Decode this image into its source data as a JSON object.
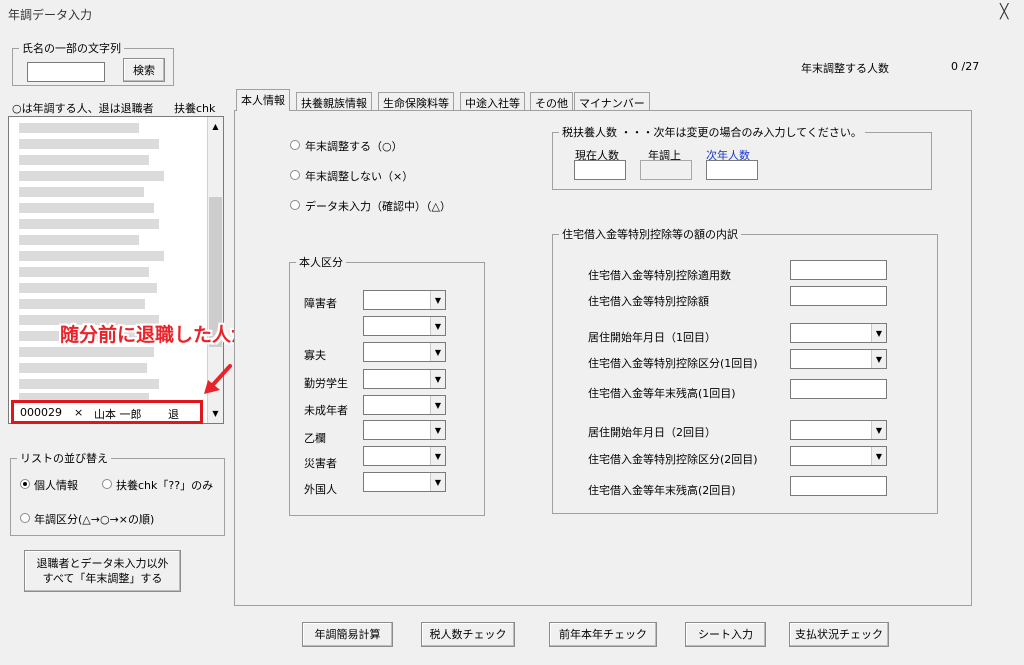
{
  "window": {
    "title": "年調データ入力",
    "close_glyph": "╳"
  },
  "search": {
    "group_label": "氏名の一部の文字列",
    "input_value": "",
    "button": "検索"
  },
  "summary": {
    "label": "年末調整する人数",
    "value": "0 /27"
  },
  "list": {
    "header_left": "○は年調する人、退は退職者",
    "header_right": "扶養chk",
    "highlight_row": {
      "code": "000029",
      "mark": "×",
      "name": "山本 一郎",
      "status": "退"
    },
    "annotation": "随分前に退職した人が表示されます"
  },
  "sort": {
    "group_label": "リストの並び替え",
    "options": [
      "個人情報",
      "扶養chk「??」のみ",
      "年調区分(△→○→×の順)"
    ],
    "selected": 0
  },
  "bulk_button": {
    "line1": "退職者とデータ未入力以外",
    "line2": "すべて「年末調整」する"
  },
  "tabs": [
    "本人情報",
    "扶養親族情報",
    "生命保険料等",
    "中途入社等",
    "その他",
    "マイナンバー"
  ],
  "adjust_options": [
    "年末調整する（○）",
    "年末調整しない（×）",
    "データ未入力（確認中）（△）"
  ],
  "person_group": {
    "label": "本人区分",
    "items": [
      "障害者",
      "",
      "寡夫",
      "勤労学生",
      "未成年者",
      "乙欄",
      "災害者",
      "外国人"
    ]
  },
  "dependents": {
    "label": "税扶養人数 ・・・次年は変更の場合のみ入力してください。",
    "current": "現在人数",
    "year_adj": "年調上",
    "next": "次年人数"
  },
  "housing": {
    "label": "住宅借入金等特別控除等の額の内訳",
    "rows": [
      "住宅借入金等特別控除適用数",
      "住宅借入金等特別控除額",
      "居住開始年月日（1回目）",
      "住宅借入金等特別控除区分(1回目)",
      "住宅借入金等年末残高(1回目)",
      "居住開始年月日（2回目）",
      "住宅借入金等特別控除区分(2回目)",
      "住宅借入金等年末残高(2回目)"
    ]
  },
  "bottom_buttons": [
    "年調簡易計算",
    "税人数チェック",
    "前年本年チェック",
    "シート入力",
    "支払状況チェック"
  ]
}
